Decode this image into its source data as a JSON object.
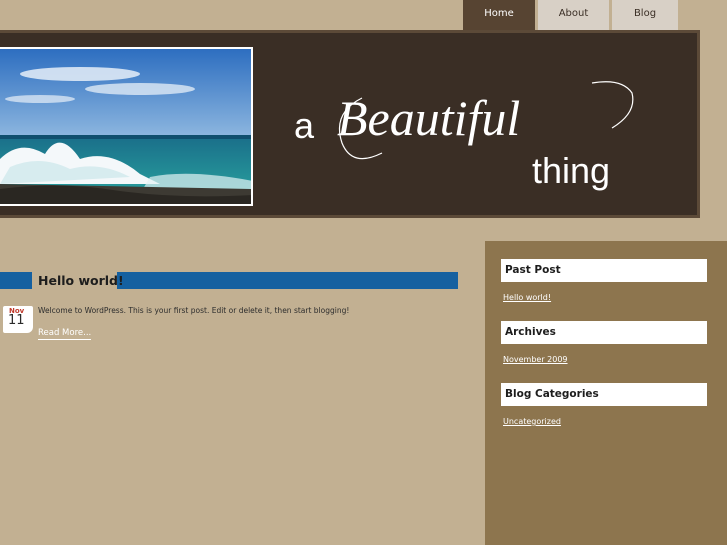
{
  "nav": {
    "tabs": [
      {
        "label": "Home",
        "active": true
      },
      {
        "label": "About",
        "active": false
      },
      {
        "label": "Blog",
        "active": false
      }
    ]
  },
  "header": {
    "logo_a": "a",
    "logo_beautiful": "Beautiful",
    "logo_thing": "thing",
    "photo_icon": "ocean-wave-photo"
  },
  "post": {
    "title": "Hello world!",
    "date_month": "Nov",
    "date_day": "11",
    "excerpt": "Welcome to WordPress. This is your first post. Edit or delete it, then start blogging!",
    "read_more": "Read More..."
  },
  "sidebar": {
    "widgets": [
      {
        "title": "Past Post",
        "link": "Hello world!"
      },
      {
        "title": "Archives",
        "link": "November 2009"
      },
      {
        "title": "Blog Categories",
        "link": "Uncategorized"
      }
    ]
  },
  "colors": {
    "background": "#c2b092",
    "header": "#3a2e25",
    "active_tab": "#574432",
    "accent_bar": "#1560a0",
    "sidebar": "#8d754e"
  }
}
